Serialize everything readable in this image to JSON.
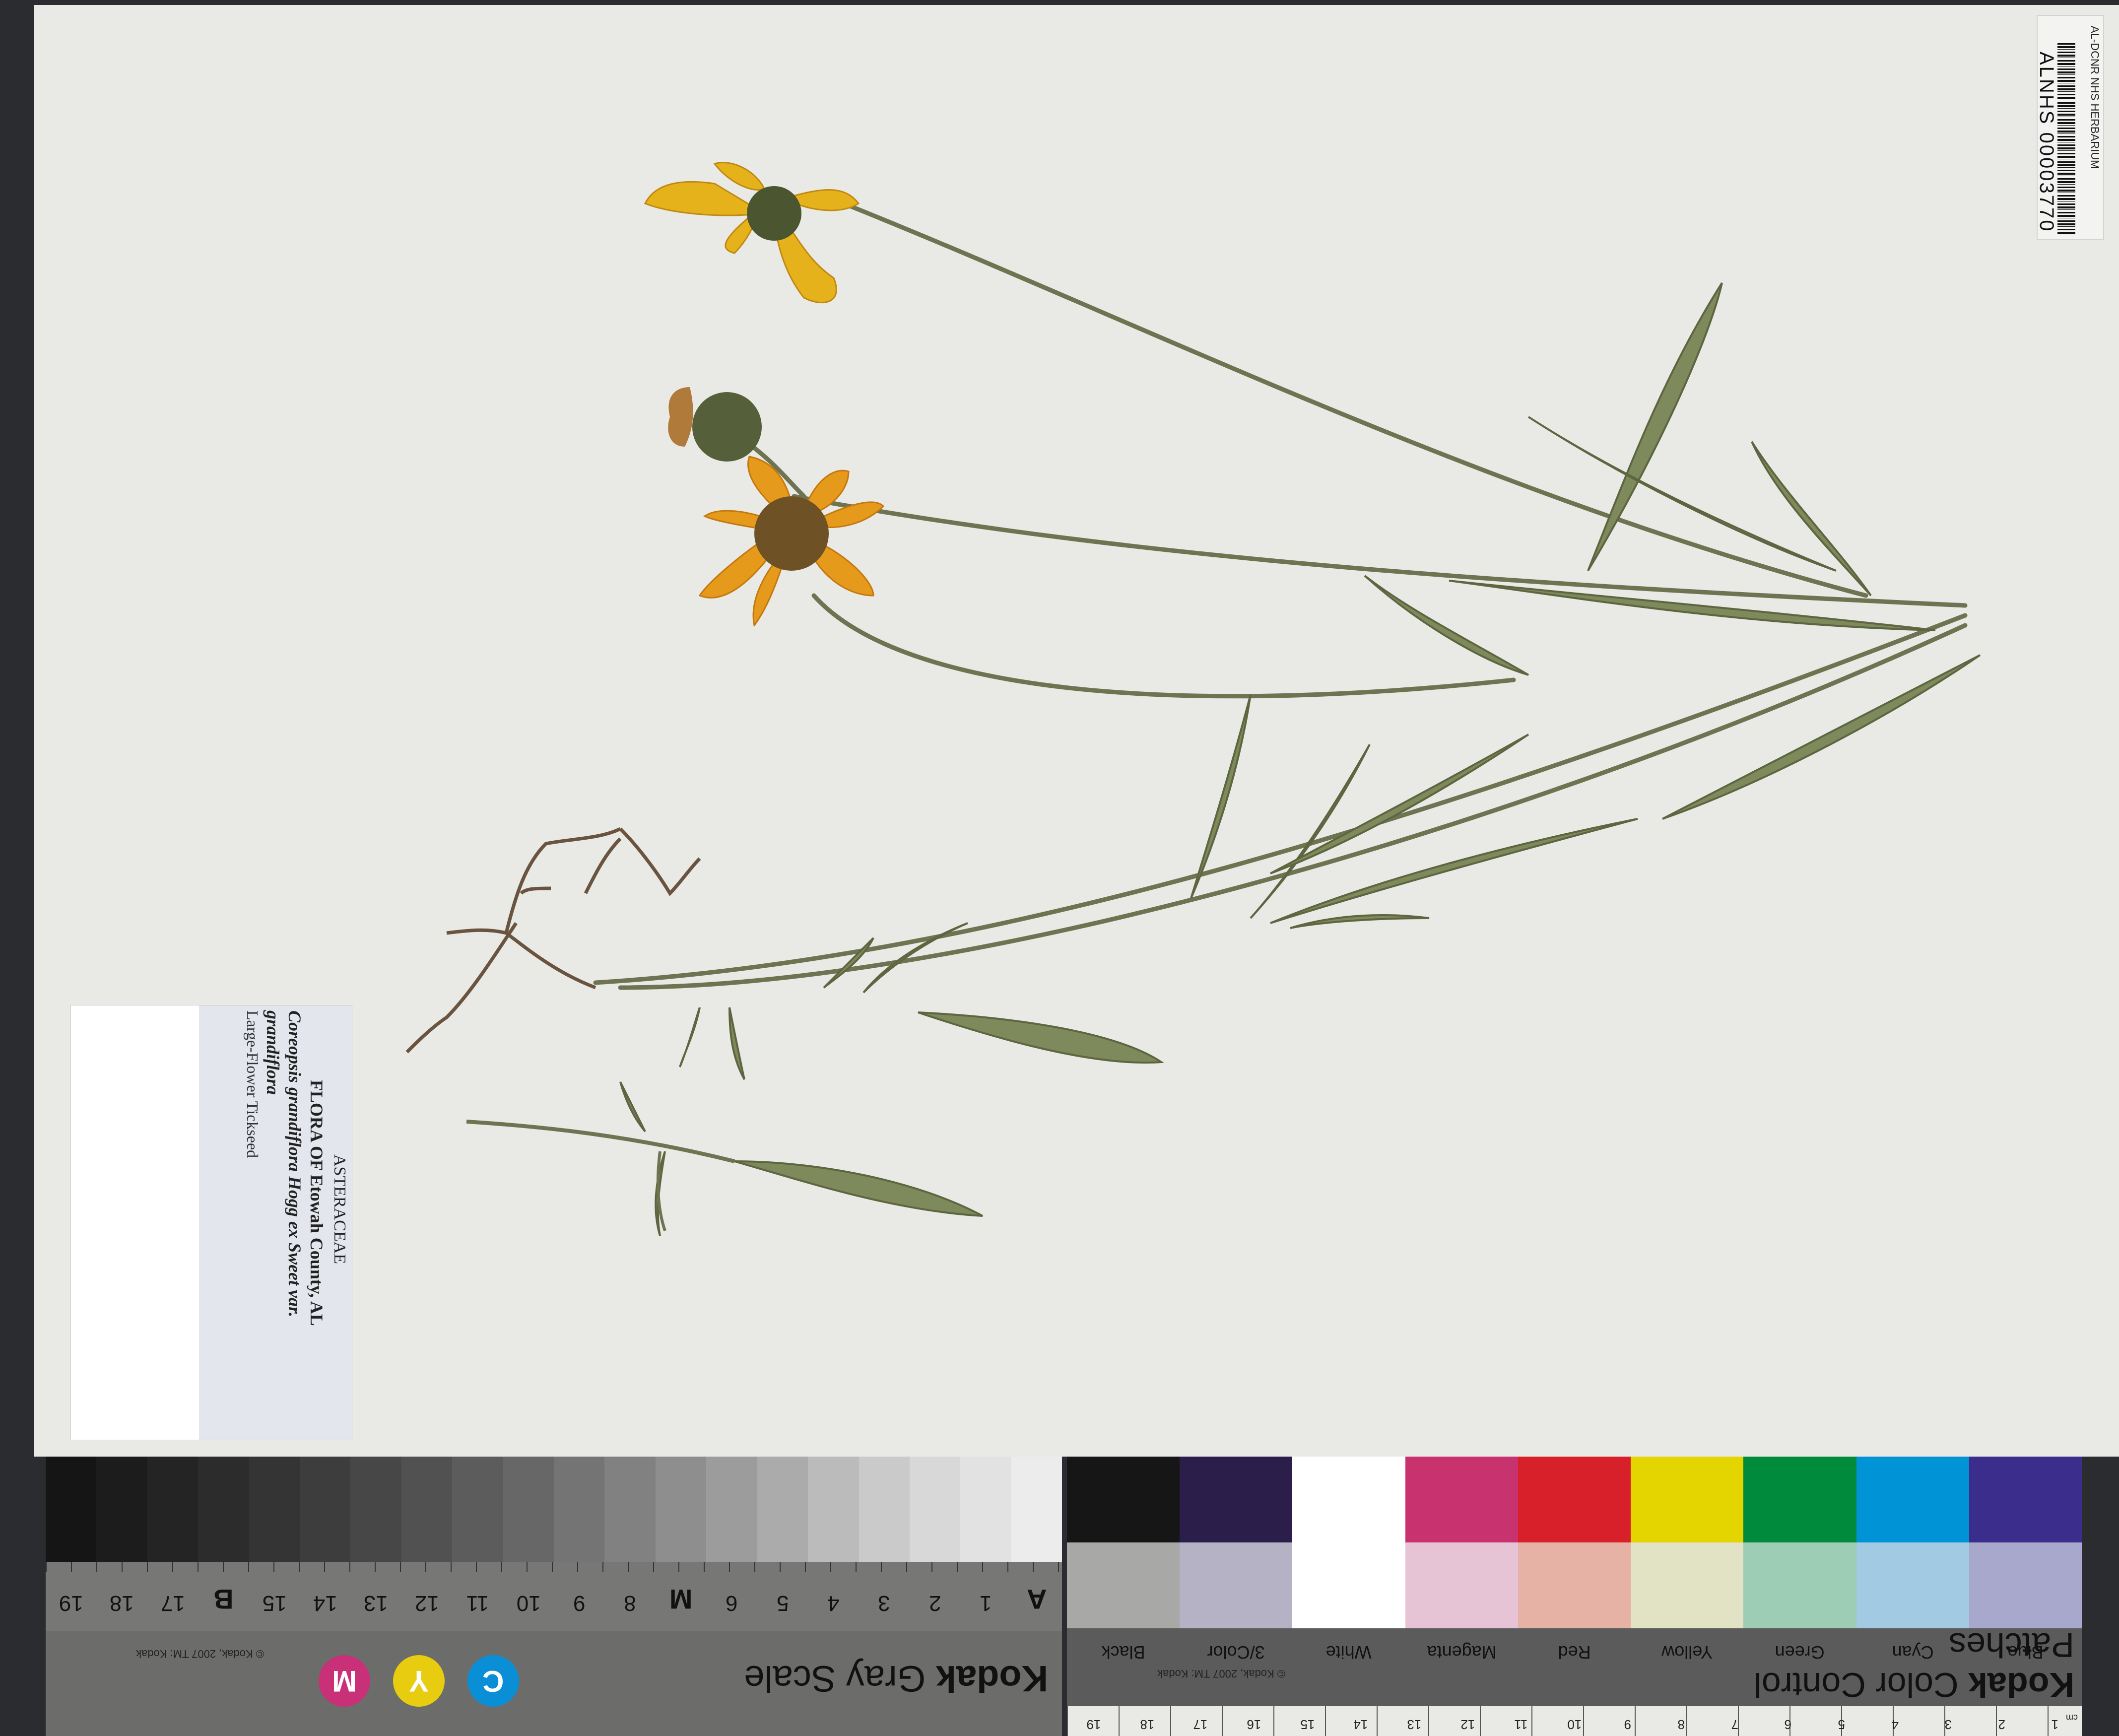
{
  "barcode_label": {
    "institution": "AL-DCNR NHS HERBARIUM",
    "catalog_number": "ALNHS 00003770"
  },
  "herbarium_label": {
    "family": "ASTERACEAE",
    "locality": "FLORA OF Etowah County, AL",
    "scientific_name_line1": "Coreopsis grandiflora Hogg ex Sweet var.",
    "scientific_name_line2": "grandiflora",
    "common_name": "Large-Flower Tickseed"
  },
  "gray_scale_card": {
    "brand": "Kodak",
    "title": "Gray Scale",
    "copyright": "© Kodak, 2007 TM: Kodak",
    "scale_labels": [
      "A",
      "1",
      "2",
      "3",
      "4",
      "5",
      "6",
      "M",
      "8",
      "9",
      "10",
      "11",
      "12",
      "13",
      "14",
      "15",
      "B",
      "17",
      "18",
      "19"
    ],
    "cmy": [
      "C",
      "Y",
      "M"
    ]
  },
  "color_card": {
    "brand": "Kodak",
    "title": "Color Control Patches",
    "copyright": "© Kodak, 2007 TM: Kodak",
    "patch_labels": [
      "Blue",
      "Cyan",
      "Green",
      "Yellow",
      "Red",
      "Magenta",
      "White",
      "3/Color",
      "Black"
    ],
    "ruler_unit": "cm",
    "ruler_numbers": [
      "1",
      "2",
      "3",
      "4",
      "5",
      "6",
      "7",
      "8",
      "9",
      "10",
      "11",
      "12",
      "13",
      "14",
      "15",
      "16",
      "17",
      "18",
      "19"
    ]
  },
  "colors": {
    "patches_top": [
      "#2c1e4a",
      "#ffffff",
      "#c8326e",
      "#d8202a",
      "#e4d400",
      "#008a3c",
      "#0093d6",
      "#3a2d8c"
    ],
    "patches_bottom": [
      "#a8a8a6",
      "#b4b2c4",
      "#ffffff",
      "#e6c4d6",
      "#e6b2a6",
      "#e2e2c4",
      "#9ecdb6",
      "#a2cae2",
      "#a8a8cc"
    ]
  }
}
